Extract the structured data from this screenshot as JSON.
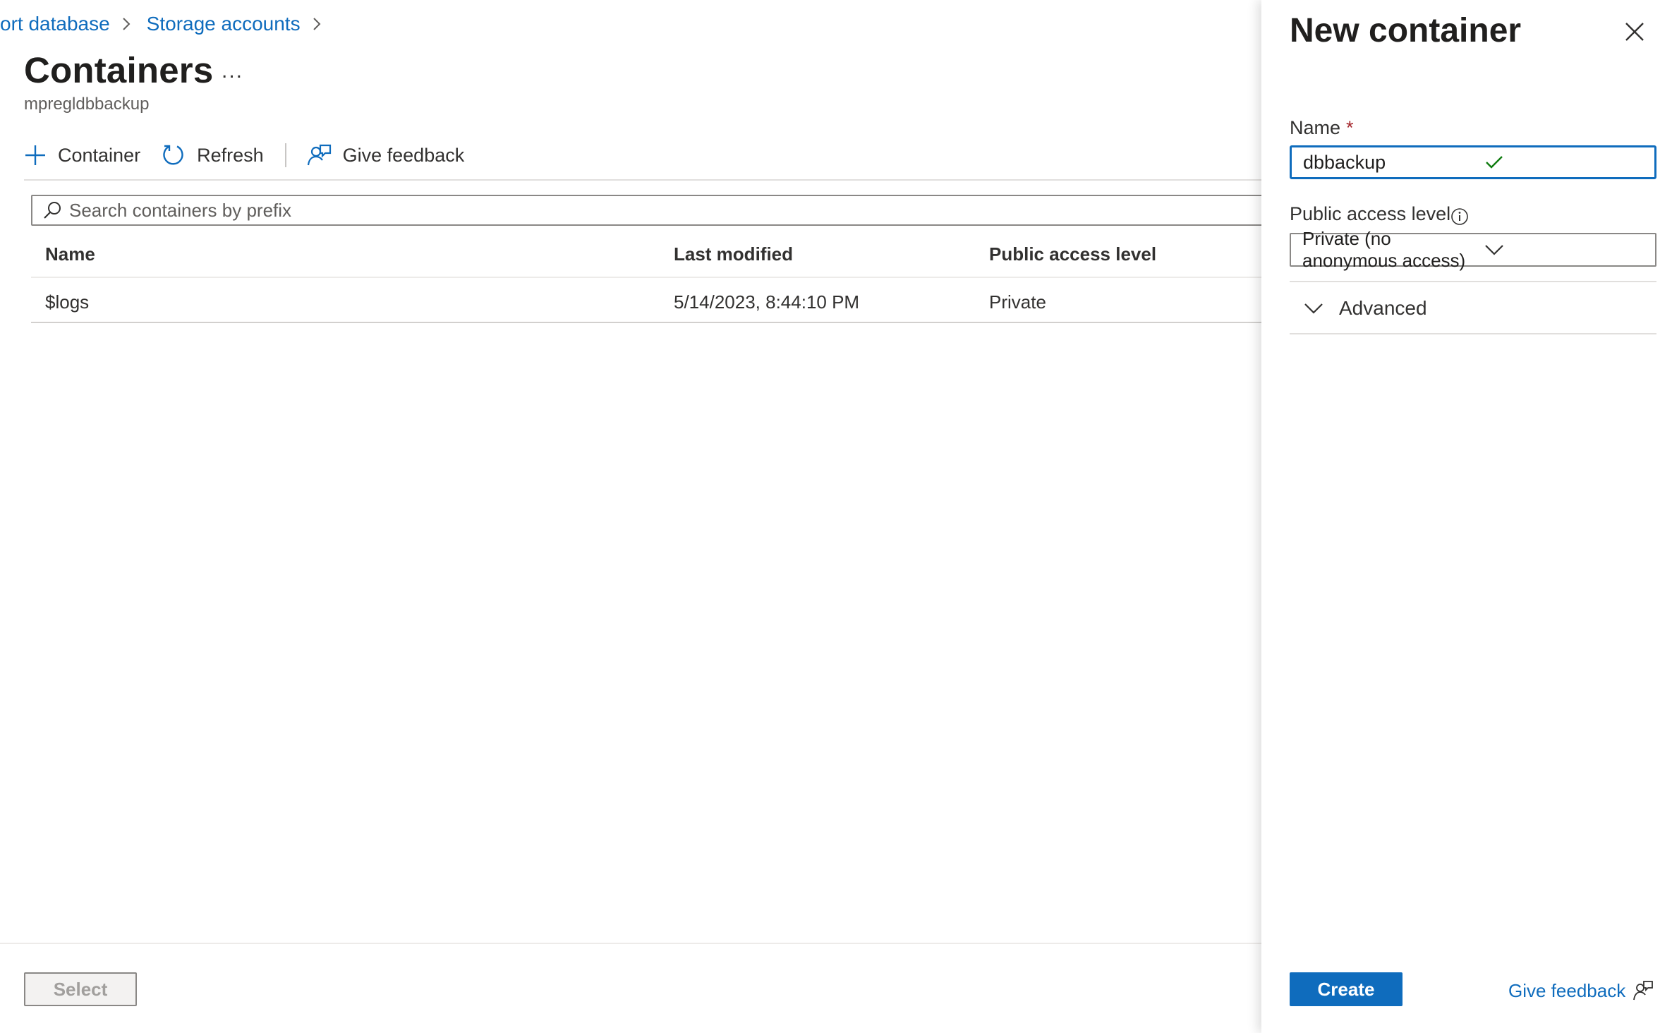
{
  "breadcrumb": {
    "item1": "ort database",
    "item2": "Storage accounts"
  },
  "page": {
    "title": "Containers",
    "more": "...",
    "subtitle": "mpregldbbackup"
  },
  "toolbar": {
    "container": "Container",
    "refresh": "Refresh",
    "feedback": "Give feedback"
  },
  "search": {
    "placeholder": "Search containers by prefix"
  },
  "table": {
    "headers": {
      "name": "Name",
      "modified": "Last modified",
      "access": "Public access level"
    },
    "rows": [
      {
        "name": "$logs",
        "modified": "5/14/2023, 8:44:10 PM",
        "access": "Private"
      }
    ]
  },
  "footer": {
    "select": "Select"
  },
  "panel": {
    "title": "New container",
    "name_label": "Name",
    "required_mark": "*",
    "name_value": "dbbackup",
    "access_label": "Public access level",
    "access_value": "Private (no anonymous access)",
    "advanced": "Advanced",
    "create": "Create",
    "feedback": "Give feedback"
  },
  "colors": {
    "accent": "#0f6cbd",
    "valid": "#107c10",
    "required": "#a4262c"
  },
  "icons": [
    "chevron-right-icon",
    "ellipsis-icon",
    "plus-icon",
    "refresh-icon",
    "feedback-icon",
    "search-icon",
    "close-icon",
    "checkmark-icon",
    "info-icon",
    "chevron-down-icon"
  ]
}
